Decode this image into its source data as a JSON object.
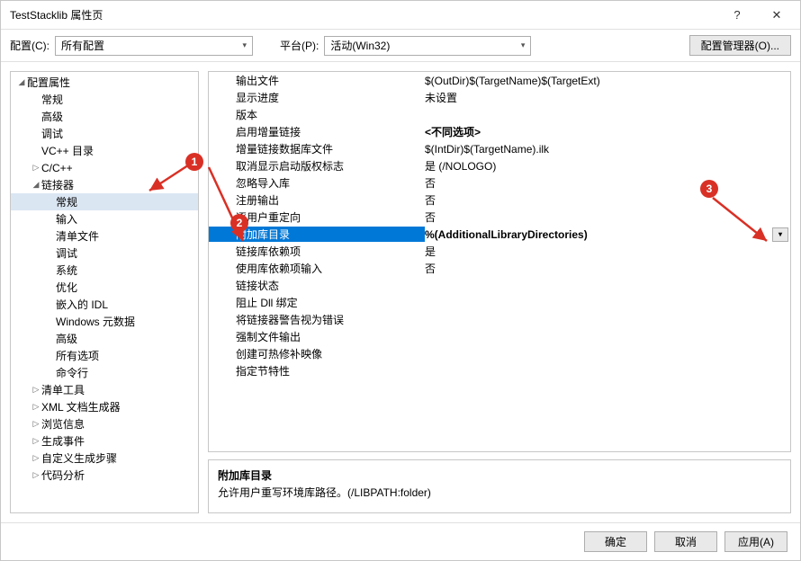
{
  "title": "TestStacklib 属性页",
  "toolbar": {
    "config_label": "配置(C):",
    "config_value": "所有配置",
    "platform_label": "平台(P):",
    "platform_value": "活动(Win32)",
    "manager_btn": "配置管理器(O)..."
  },
  "tree": {
    "root": "配置属性",
    "items_l1a": [
      "常规",
      "高级",
      "调试",
      "VC++ 目录"
    ],
    "cxx_label": "C/C++",
    "linker_label": "链接器",
    "linker_children": [
      "常规",
      "输入",
      "清单文件",
      "调试",
      "系统",
      "优化",
      "嵌入的 IDL",
      "Windows 元数据",
      "高级",
      "所有选项",
      "命令行"
    ],
    "items_l1b": [
      "清单工具",
      "XML 文档生成器",
      "浏览信息",
      "生成事件",
      "自定义生成步骤",
      "代码分析"
    ]
  },
  "grid": [
    {
      "name": "输出文件",
      "value": "$(OutDir)$(TargetName)$(TargetExt)"
    },
    {
      "name": "显示进度",
      "value": "未设置"
    },
    {
      "name": "版本",
      "value": ""
    },
    {
      "name": "启用增量链接",
      "value": "<不同选项>",
      "bold": true
    },
    {
      "name": "增量链接数据库文件",
      "value": "$(IntDir)$(TargetName).ilk"
    },
    {
      "name": "取消显示启动版权标志",
      "value": "是 (/NOLOGO)"
    },
    {
      "name": "忽略导入库",
      "value": "否"
    },
    {
      "name": "注册输出",
      "value": "否"
    },
    {
      "name": "逐用户重定向",
      "value": "否"
    },
    {
      "name": "附加库目录",
      "value": "%(AdditionalLibraryDirectories)",
      "selected": true,
      "dropdown": true
    },
    {
      "name": "链接库依赖项",
      "value": "是"
    },
    {
      "name": "使用库依赖项输入",
      "value": "否"
    },
    {
      "name": "链接状态",
      "value": ""
    },
    {
      "name": "阻止 Dll 绑定",
      "value": ""
    },
    {
      "name": "将链接器警告视为错误",
      "value": ""
    },
    {
      "name": "强制文件输出",
      "value": ""
    },
    {
      "name": "创建可热修补映像",
      "value": ""
    },
    {
      "name": "指定节特性",
      "value": ""
    }
  ],
  "description": {
    "title": "附加库目录",
    "body": "允许用户重写环境库路径。(/LIBPATH:folder)"
  },
  "footer": {
    "ok": "确定",
    "cancel": "取消",
    "apply": "应用(A)"
  },
  "annotations": {
    "a1": "1",
    "a2": "2",
    "a3": "3"
  }
}
